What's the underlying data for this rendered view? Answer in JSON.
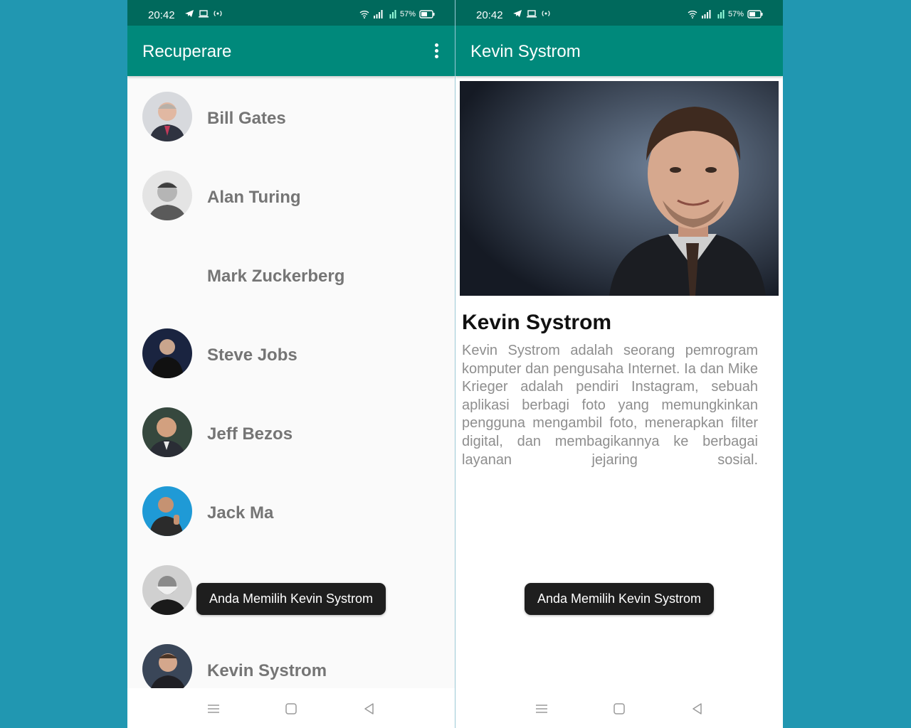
{
  "status_bar": {
    "time": "20:42",
    "battery": "57%"
  },
  "list_screen": {
    "title": "Recuperare",
    "items": [
      {
        "name": "Bill Gates",
        "has_photo": true
      },
      {
        "name": "Alan Turing",
        "has_photo": true
      },
      {
        "name": "Mark Zuckerberg",
        "has_photo": false
      },
      {
        "name": "Steve Jobs",
        "has_photo": true
      },
      {
        "name": "Jeff Bezos",
        "has_photo": true
      },
      {
        "name": "Jack Ma",
        "has_photo": true
      },
      {
        "name": "",
        "has_photo": true
      },
      {
        "name": "Kevin Systrom",
        "has_photo": true
      }
    ],
    "toast": "Anda Memilih Kevin Systrom"
  },
  "detail_screen": {
    "title": "Kevin Systrom",
    "name": "Kevin Systrom",
    "description": "Kevin Systrom adalah seorang pemrogram komputer dan pengusaha Internet. Ia dan Mike Krieger adalah pendiri Instagram, sebuah aplikasi berbagi foto yang memungkinkan pengguna mengambil foto, menerapkan filter digital, dan membagikannya ke berbagai layanan jejaring sosial.",
    "toast": "Anda Memilih Kevin Systrom"
  },
  "colors": {
    "primary": "#00897b",
    "primary_dark": "#00695c",
    "background": "#2197b1"
  }
}
